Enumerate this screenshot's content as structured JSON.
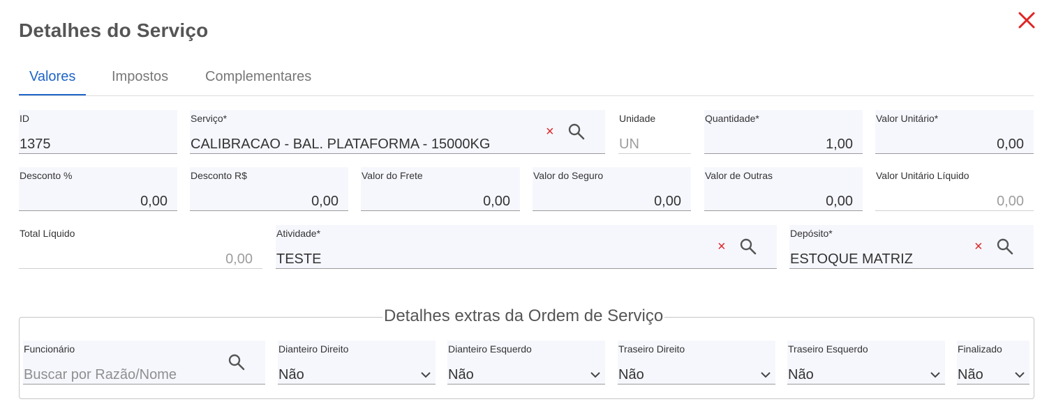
{
  "dialog": {
    "title": "Detalhes do Serviço",
    "close_icon": "close-icon",
    "accent_color": "#1e64c8",
    "danger_color": "#e02424"
  },
  "tabs": [
    {
      "label": "Valores",
      "active": true
    },
    {
      "label": "Impostos",
      "active": false
    },
    {
      "label": "Complementares",
      "active": false
    }
  ],
  "fields": {
    "id": {
      "label": "ID",
      "value": "1375"
    },
    "servico": {
      "label": "Serviço*",
      "value": "CALIBRACAO - BAL. PLATAFORMA - 15000KG"
    },
    "unidade": {
      "label": "Unidade",
      "value": "UN"
    },
    "quantidade": {
      "label": "Quantidade*",
      "value": "1,00"
    },
    "valor_unitario": {
      "label": "Valor Unitário*",
      "value": "0,00"
    },
    "desconto_pct": {
      "label": "Desconto %",
      "value": "0,00"
    },
    "desconto_rs": {
      "label": "Desconto R$",
      "value": "0,00"
    },
    "valor_frete": {
      "label": "Valor do Frete",
      "value": "0,00"
    },
    "valor_seguro": {
      "label": "Valor do Seguro",
      "value": "0,00"
    },
    "valor_outras": {
      "label": "Valor de Outras",
      "value": "0,00"
    },
    "valor_unit_liquido": {
      "label": "Valor Unitário Líquido",
      "value": "0,00"
    },
    "total_liquido": {
      "label": "Total Líquido",
      "value": "0,00"
    },
    "atividade": {
      "label": "Atividade*",
      "value": "TESTE"
    },
    "deposito": {
      "label": "Depósito*",
      "value": "ESTOQUE MATRIZ"
    }
  },
  "extras": {
    "legend": "Detalhes extras da Ordem de Serviço",
    "funcionario": {
      "label": "Funcionário",
      "placeholder": "Buscar por Razão/Nome"
    },
    "dianteiro_direito": {
      "label": "Dianteiro Direito",
      "value": "Não"
    },
    "dianteiro_esquerdo": {
      "label": "Dianteiro Esquerdo",
      "value": "Não"
    },
    "traseiro_direito": {
      "label": "Traseiro Direito",
      "value": "Não"
    },
    "traseiro_esquerdo": {
      "label": "Traseiro Esquerdo",
      "value": "Não"
    },
    "finalizado": {
      "label": "Finalizado",
      "value": "Não"
    }
  }
}
